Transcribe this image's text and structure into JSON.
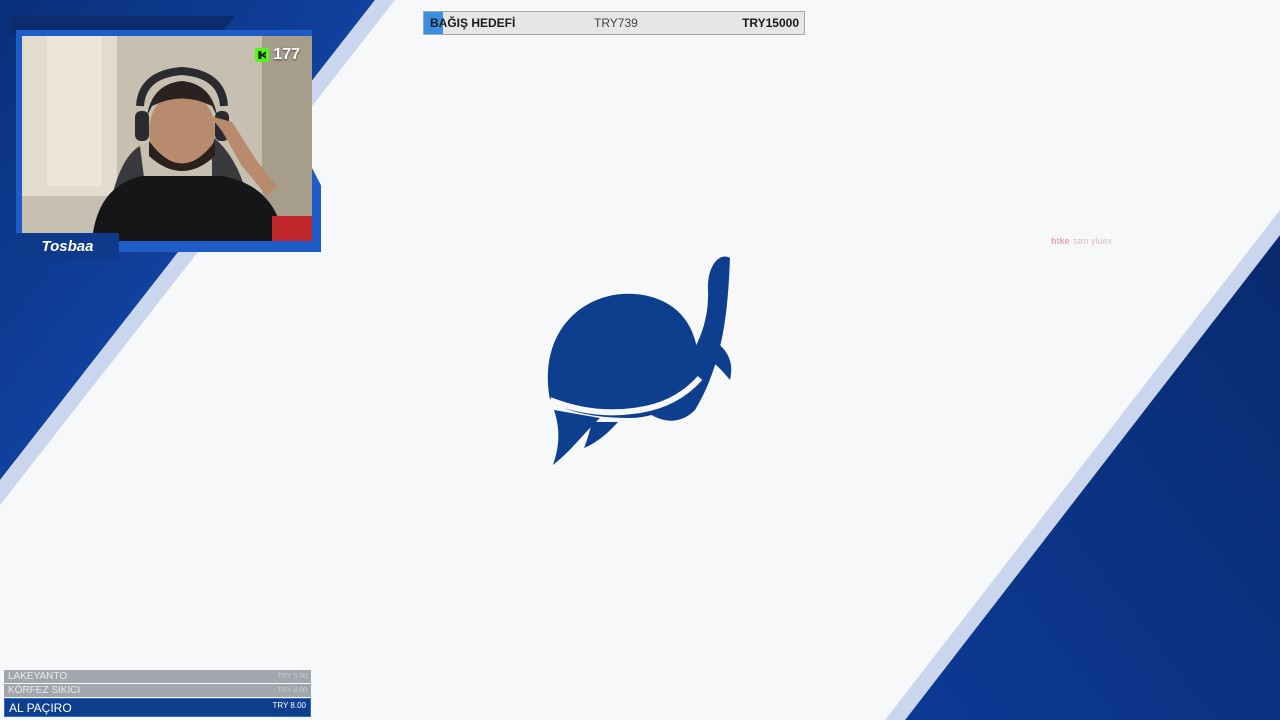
{
  "webcam": {
    "streamer_name": "Tosbaa",
    "viewer_count": "177",
    "viewer_icon": "kick-logo-icon"
  },
  "donation_goal": {
    "title": "BAĞIŞ HEDEFİ",
    "current": "TRY739",
    "target": "TRY15000",
    "progress_fraction": 0.049
  },
  "alert": {
    "user": "htke",
    "message": "tam yluex"
  },
  "donations": [
    {
      "name": "LAKEYANTO",
      "amount": "TRY 5.00"
    },
    {
      "name": "KÖRFEZ SIKICI",
      "amount": "TRY 8.00"
    },
    {
      "name": "AL PAÇIRO",
      "amount": "TRY 8.00"
    }
  ],
  "colors": {
    "brand_blue": "#0e3f8f",
    "accent_blue": "#1e5cc7",
    "background": "#f7f8fa"
  }
}
